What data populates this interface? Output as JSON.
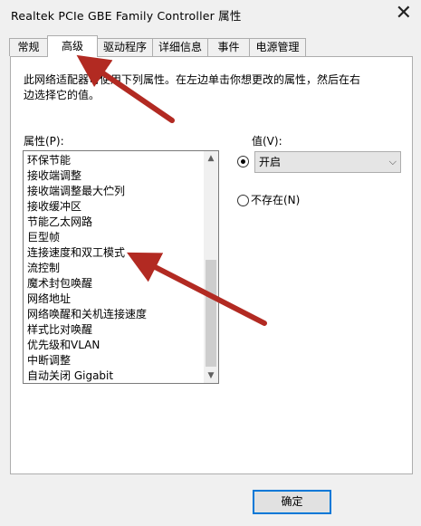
{
  "window": {
    "title": "Realtek PCIe GBE Family Controller 属性",
    "close_glyph": "✕"
  },
  "tabs": [
    {
      "label": "常规",
      "active": false
    },
    {
      "label": "高级",
      "active": true
    },
    {
      "label": "驱动程序",
      "active": false
    },
    {
      "label": "详细信息",
      "active": false
    },
    {
      "label": "事件",
      "active": false
    },
    {
      "label": "电源管理",
      "active": false
    }
  ],
  "advanced": {
    "description": "此网络适配器可使用下列属性。在左边单击你想更改的属性，然后在右边选择它的值。",
    "property_label": "属性(P):",
    "properties": [
      "环保节能",
      "接收端调整",
      "接收端调整最大伫列",
      "接收缓冲区",
      "节能乙太网路",
      "巨型帧",
      "连接速度和双工模式",
      "流控制",
      "魔术封包唤醒",
      "网络地址",
      "网络唤醒和关机连接速度",
      "样式比对唤醒",
      "优先级和VLAN",
      "中断调整",
      "自动关闭 Gigabit"
    ],
    "scroll_up_glyph": "▲",
    "scroll_down_glyph": "▼",
    "value_label": "值(V):",
    "value_selected": "开启",
    "value_radio_selected": true,
    "dropdown_glyph": "⌵",
    "not_present_label": "不存在(N)",
    "not_present_selected": false
  },
  "footer": {
    "ok_label": "确定"
  },
  "annotation_color": "#b22a22"
}
